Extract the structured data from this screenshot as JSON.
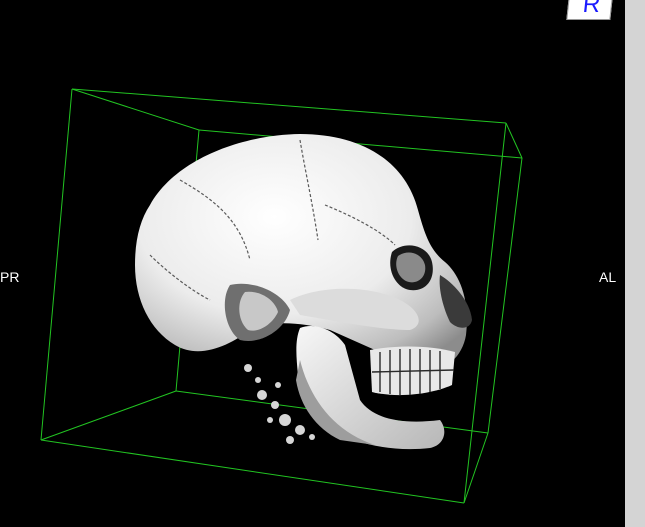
{
  "viewer": {
    "orientation_left": "PR",
    "orientation_right": "AL",
    "cube_label": "R",
    "bounding_box_color": "#22c422",
    "background_color": "#000000"
  }
}
